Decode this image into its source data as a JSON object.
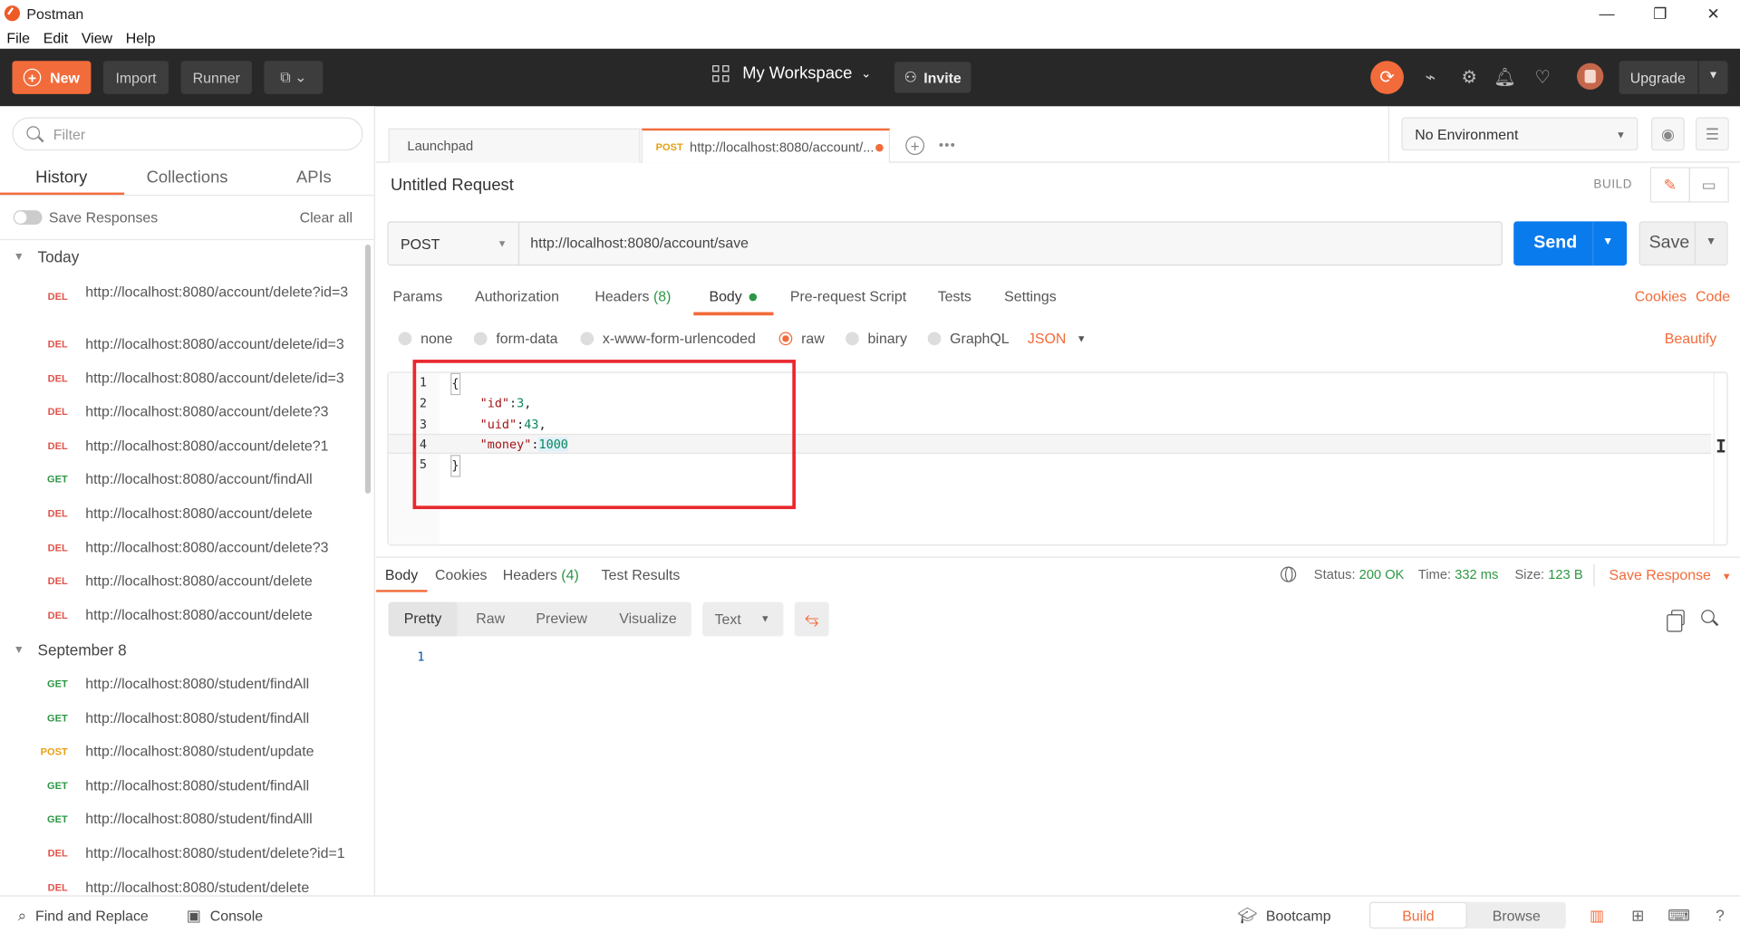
{
  "window": {
    "title": "Postman",
    "controls": [
      "—",
      "❐",
      "✕"
    ]
  },
  "menu": [
    "File",
    "Edit",
    "View",
    "Help"
  ],
  "header": {
    "new_label": "New",
    "import_label": "Import",
    "runner_label": "Runner",
    "workspace_label": "My Workspace",
    "invite_label": "Invite",
    "upgrade_label": "Upgrade"
  },
  "sidebar": {
    "filter_placeholder": "Filter",
    "tabs": [
      "History",
      "Collections",
      "APIs"
    ],
    "save_responses_label": "Save Responses",
    "clear_all_label": "Clear all",
    "groups": [
      {
        "title": "Today",
        "items": [
          {
            "method": "DEL",
            "url": "http://localhost:8080/account/delete?id=3"
          },
          {
            "method": "DEL",
            "url": "http://localhost:8080/account/delete/id=3"
          },
          {
            "method": "DEL",
            "url": "http://localhost:8080/account/delete/id=3"
          },
          {
            "method": "DEL",
            "url": "http://localhost:8080/account/delete?3"
          },
          {
            "method": "DEL",
            "url": "http://localhost:8080/account/delete?1"
          },
          {
            "method": "GET",
            "url": "http://localhost:8080/account/findAll"
          },
          {
            "method": "DEL",
            "url": "http://localhost:8080/account/delete"
          },
          {
            "method": "DEL",
            "url": "http://localhost:8080/account/delete?3"
          },
          {
            "method": "DEL",
            "url": "http://localhost:8080/account/delete"
          },
          {
            "method": "DEL",
            "url": "http://localhost:8080/account/delete"
          }
        ]
      },
      {
        "title": "September 8",
        "items": [
          {
            "method": "GET",
            "url": "http://localhost:8080/student/findAll"
          },
          {
            "method": "GET",
            "url": "http://localhost:8080/student/findAll"
          },
          {
            "method": "POST",
            "url": "http://localhost:8080/student/update"
          },
          {
            "method": "GET",
            "url": "http://localhost:8080/student/findAll"
          },
          {
            "method": "GET",
            "url": "http://localhost:8080/student/findAlll"
          },
          {
            "method": "DEL",
            "url": "http://localhost:8080/student/delete?id=1"
          },
          {
            "method": "DEL",
            "url": "http://localhost:8080/student/delete"
          }
        ]
      }
    ]
  },
  "tabs": {
    "launchpad_label": "Launchpad",
    "active_method": "POST",
    "active_label": "http://localhost:8080/account/..."
  },
  "environment": {
    "selected": "No Environment"
  },
  "request": {
    "title": "Untitled Request",
    "build_label": "BUILD",
    "method": "POST",
    "url": "http://localhost:8080/account/save",
    "send_label": "Send",
    "save_label": "Save",
    "tabs": {
      "params": "Params",
      "authorization": "Authorization",
      "headers": "Headers",
      "headers_count": "(8)",
      "body": "Body",
      "prerequest": "Pre-request Script",
      "tests": "Tests",
      "settings": "Settings"
    },
    "cookies_label": "Cookies",
    "code_label": "Code",
    "body_types": [
      "none",
      "form-data",
      "x-www-form-urlencoded",
      "raw",
      "binary",
      "GraphQL"
    ],
    "selected_body_type": "raw",
    "format": "JSON",
    "beautify_label": "Beautify",
    "code_lines": [
      {
        "n": "1",
        "key": "",
        "value": "",
        "raw": "{"
      },
      {
        "n": "2",
        "key": "\"id\"",
        "value": "3",
        "suffix": ","
      },
      {
        "n": "3",
        "key": "\"uid\"",
        "value": "43",
        "suffix": ","
      },
      {
        "n": "4",
        "key": "\"money\"",
        "value": "1000",
        "suffix": ""
      },
      {
        "n": "5",
        "key": "",
        "value": "",
        "raw": "}"
      }
    ]
  },
  "response": {
    "tabs": {
      "body": "Body",
      "cookies": "Cookies",
      "headers": "Headers",
      "headers_count": "(4)",
      "test_results": "Test Results"
    },
    "status_label": "Status:",
    "status_value": "200 OK",
    "time_label": "Time:",
    "time_value": "332 ms",
    "size_label": "Size:",
    "size_value": "123 B",
    "save_response_label": "Save Response",
    "views": [
      "Pretty",
      "Raw",
      "Preview",
      "Visualize"
    ],
    "active_view": "Pretty",
    "text_format": "Text",
    "line_number": "1"
  },
  "statusbar": {
    "find_replace": "Find and Replace",
    "console": "Console",
    "bootcamp": "Bootcamp",
    "build": "Build",
    "browse": "Browse"
  },
  "colors": {
    "accent": "#f26b3a",
    "send_blue": "#097bed",
    "get_green": "#2d9745",
    "del_red": "#e0534a",
    "post_yellow": "#e7a012",
    "annotation_red": "#e8282e"
  }
}
